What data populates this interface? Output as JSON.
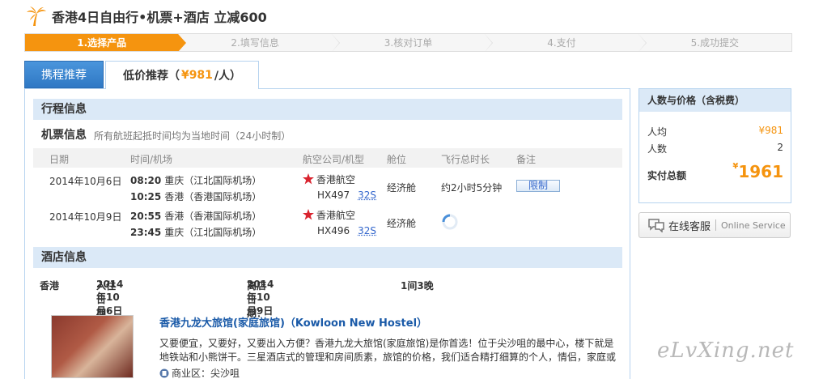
{
  "header": {
    "title": "香港4日自由行•机票+酒店 立减600",
    "logo_icon": "palm-tree-icon"
  },
  "steps": [
    "1.选择产品",
    "2.填写信息",
    "3.核对订单",
    "4.支付",
    "5.成功提交"
  ],
  "tabs": {
    "tab1": "携程推荐",
    "tab2_prefix": "低价推荐（",
    "tab2_price": "¥981",
    "tab2_suffix": "/人）"
  },
  "itinerary": {
    "title": "行程信息",
    "flight_title": "机票信息",
    "flight_note": "所有航班起抵时间均为当地时间（24小时制）",
    "columns": [
      "日期",
      "时间/机场",
      "航空公司/机型",
      "舱位",
      "飞行总时长",
      "备注"
    ],
    "flights": [
      {
        "date": "2014年10月6日",
        "dep_time": "08:20",
        "dep_airport": "重庆（江北国际机场）",
        "arr_time": "10:25",
        "arr_airport": "香港（香港国际机场）",
        "airline": "香港航空",
        "flight_no": "HX497",
        "plane": "32S",
        "cabin": "经济舱",
        "duration": "约2小时5分钟",
        "note": "限制"
      },
      {
        "date": "2014年10月9日",
        "dep_time": "20:55",
        "dep_airport": "香港（香港国际机场）",
        "arr_time": "23:45",
        "arr_airport": "重庆（江北国际机场）",
        "airline": "香港航空",
        "flight_no": "HX496",
        "plane": "32S",
        "cabin": "经济舱",
        "duration": "",
        "note": ""
      }
    ]
  },
  "hotel": {
    "title": "酒店信息",
    "city": "香港",
    "checkin_label": "入住日期：",
    "checkin": "2014年10月6日",
    "checkout_label": "离店日期：",
    "checkout": "2014年10月9日",
    "rooms": "1间3晚",
    "name": "香港九龙大旅馆(家庭旅馆)（Kowloon New Hostel）",
    "desc": "又要便宜，又要好，又要出入方便？香港九龙大旅馆(家庭旅馆)是你首选！位于尖沙咀的最中心，楼下就是地铁站和小熊饼干。三星酒店式的管理和房间质素，旅馆的价格，我们适合精打细算的个人，情侣，家庭或",
    "area_label": "商业区：尖沙咀"
  },
  "price": {
    "title": "人数与价格（含税费）",
    "per_label": "人均",
    "per_value": "¥981",
    "count_label": "人数",
    "count_value": "2",
    "total_label": "实付总额",
    "total_symbol": "¥",
    "total_value": "1961"
  },
  "service": {
    "cn": "在线客服",
    "en": "Online Service"
  },
  "watermark": "eLvXing.net",
  "colors": {
    "accent": "#f5940f",
    "blue": "#2f78c4",
    "panel": "#dbe9f7",
    "link": "#1a5aa8"
  }
}
